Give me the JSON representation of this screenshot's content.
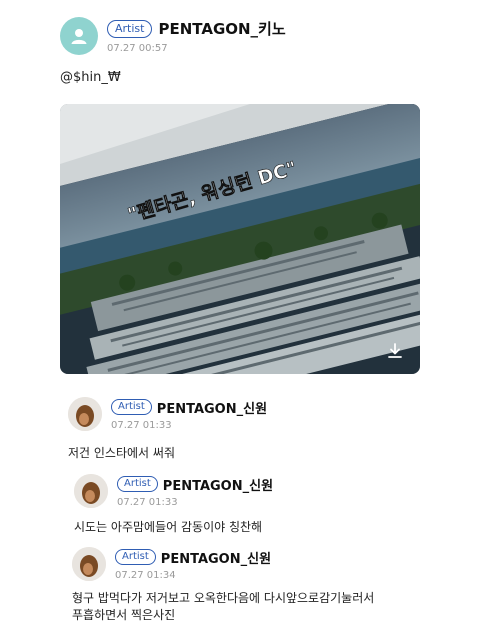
{
  "post": {
    "badge": "Artist",
    "author": "PENTAGON_키노",
    "timestamp": "07.27 00:57",
    "text": "@$hin_₩",
    "image_caption": "\"펜타곤, 워싱턴 DC\""
  },
  "comments": [
    {
      "badge": "Artist",
      "author": "PENTAGON_신원",
      "timestamp": "07.27 01:33",
      "text": "저건 인스타에서 써줘"
    },
    {
      "badge": "Artist",
      "author": "PENTAGON_신원",
      "timestamp": "07.27 01:33",
      "text": "시도는 아주맘에들어 감동이야 칭찬해"
    },
    {
      "badge": "Artist",
      "author": "PENTAGON_신원",
      "timestamp": "07.27 01:34",
      "text_lines": [
        "형구 밥먹다가 저거보고 오옥한다음에 다시앞으로감기눌러서",
        "푸흡하면서 찍은사진"
      ]
    }
  ],
  "icons": {
    "avatar": "user-icon",
    "download": "download-icon"
  },
  "colors": {
    "badge": "#2f5db3",
    "avatar_bg": "#8fd3cf",
    "timestamp": "#9a9a9a"
  }
}
